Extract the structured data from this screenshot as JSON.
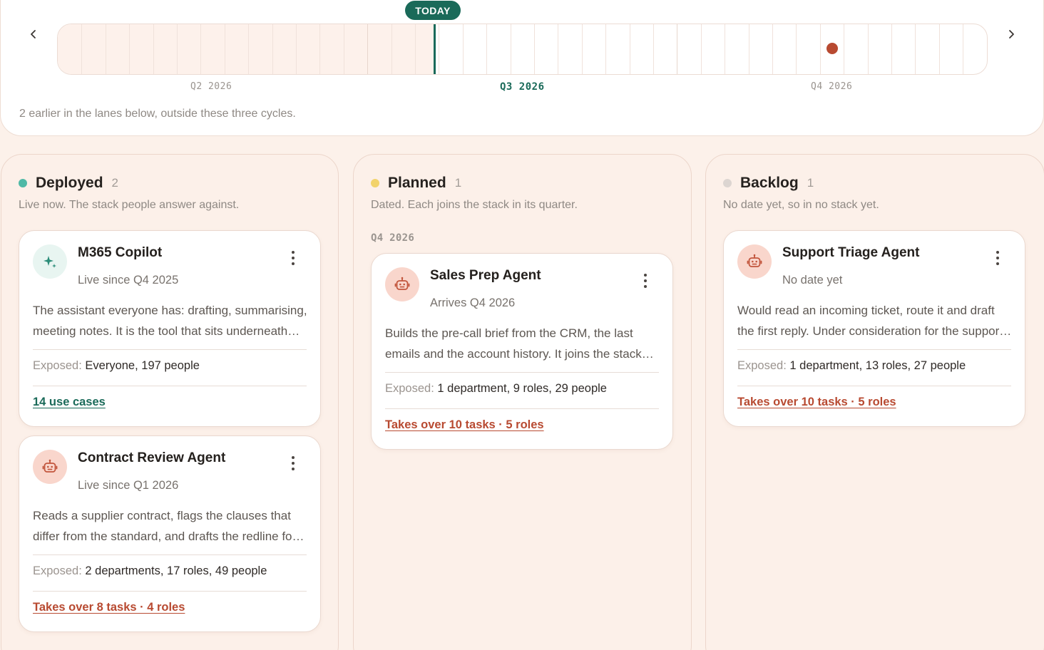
{
  "timeline": {
    "today_label": "TODAY",
    "quarters": [
      "Q2 2026",
      "Q3 2026",
      "Q4 2026"
    ],
    "note": "2 earlier in the lanes below, outside these three cycles."
  },
  "colors": {
    "accent": "#1a6a59",
    "rust": "#b84a31",
    "deployed": "#4fb9a6",
    "planned": "#f2d36b",
    "backlog": "#dcd5d1"
  },
  "lanes": {
    "deployed": {
      "title": "Deployed",
      "count": "2",
      "subtitle": "Live now. The stack people answer against.",
      "cards": [
        {
          "icon": "sparkle-icon",
          "title": "M365 Copilot",
          "meta": "Live since Q4 2025",
          "description": "The assistant everyone has: drafting, summarising, meeting notes. It is the tool that sits underneath everything else.",
          "exposed_label": "Exposed:",
          "exposed_value": "Everyone, 197 people",
          "link": "14 use cases"
        },
        {
          "icon": "robot-icon",
          "title": "Contract Review Agent",
          "meta": "Live since Q1 2026",
          "description": "Reads a supplier contract, flags the clauses that differ from the standard, and drafts the redline for legal review.",
          "exposed_label": "Exposed:",
          "exposed_value": "2 departments, 17 roles, 49 people",
          "link": "Takes over 8 tasks · 4 roles"
        }
      ]
    },
    "planned": {
      "title": "Planned",
      "count": "1",
      "subtitle": "Dated. Each joins the stack in its quarter.",
      "group_label": "Q4 2026",
      "cards": [
        {
          "icon": "robot-icon",
          "title": "Sales Prep Agent",
          "meta": "Arrives Q4 2026",
          "description": "Builds the pre-call brief from the CRM, the last emails and the account history. It joins the stack alongside Copilot.",
          "exposed_label": "Exposed:",
          "exposed_value": "1 department, 9 roles, 29 people",
          "link": "Takes over 10 tasks · 5 roles"
        }
      ]
    },
    "backlog": {
      "title": "Backlog",
      "count": "1",
      "subtitle": "No date yet, so in no stack yet.",
      "cards": [
        {
          "icon": "robot-icon",
          "title": "Support Triage Agent",
          "meta": "No date yet",
          "description": "Would read an incoming ticket, route it and draft the first reply. Under consideration for the support team.",
          "exposed_label": "Exposed:",
          "exposed_value": "1 department, 13 roles, 27 people",
          "link": "Takes over 10 tasks · 5 roles"
        }
      ]
    }
  }
}
